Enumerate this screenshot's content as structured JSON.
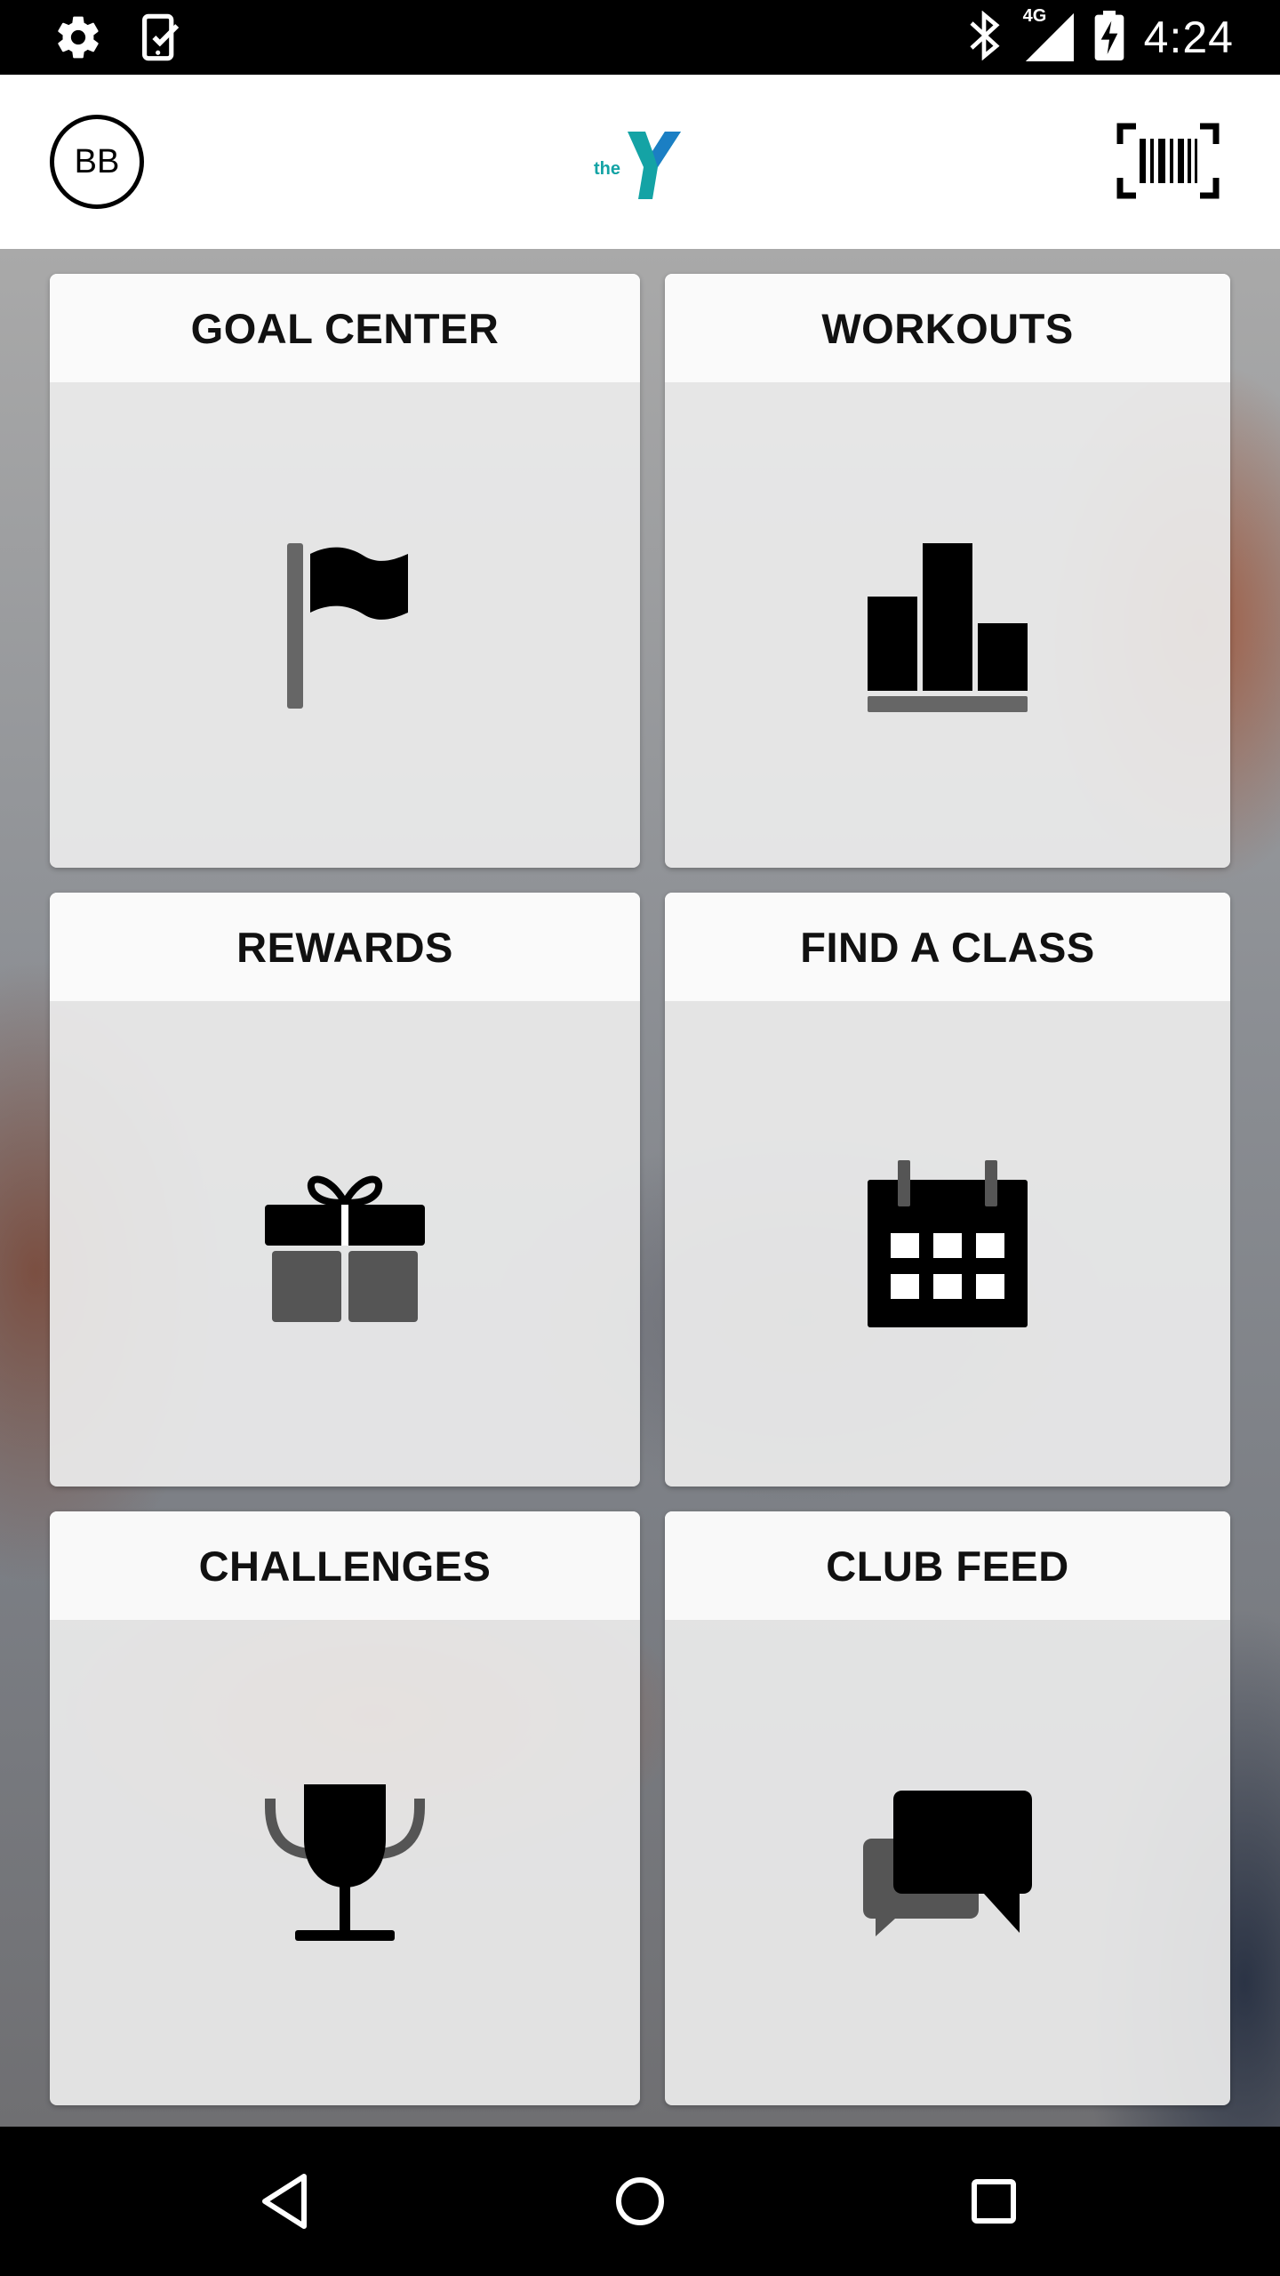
{
  "status_bar": {
    "time": "4:24",
    "network": "4G",
    "icons": [
      "settings-icon",
      "clipboard-check-icon",
      "bluetooth-icon",
      "signal-icon",
      "battery-charging-icon"
    ]
  },
  "header": {
    "avatar_initials": "BB",
    "logo_text": "the",
    "logo_icon": "ymca-logo",
    "barcode_icon": "barcode-icon"
  },
  "tiles": [
    {
      "label": "GOAL CENTER",
      "icon": "flag-icon"
    },
    {
      "label": "WORKOUTS",
      "icon": "bar-chart-icon"
    },
    {
      "label": "REWARDS",
      "icon": "gift-icon"
    },
    {
      "label": "FIND A CLASS",
      "icon": "calendar-icon"
    },
    {
      "label": "CHALLENGES",
      "icon": "trophy-icon"
    },
    {
      "label": "CLUB FEED",
      "icon": "chat-bubbles-icon"
    }
  ],
  "nav_bar": {
    "icons": [
      "back-icon",
      "home-icon",
      "recents-icon"
    ]
  },
  "colors": {
    "logo_teal": "#14a3a5",
    "logo_blue": "#1b7fc4",
    "tile_header_bg": "#fafafa",
    "tile_body_bg": "#ebebeb"
  }
}
